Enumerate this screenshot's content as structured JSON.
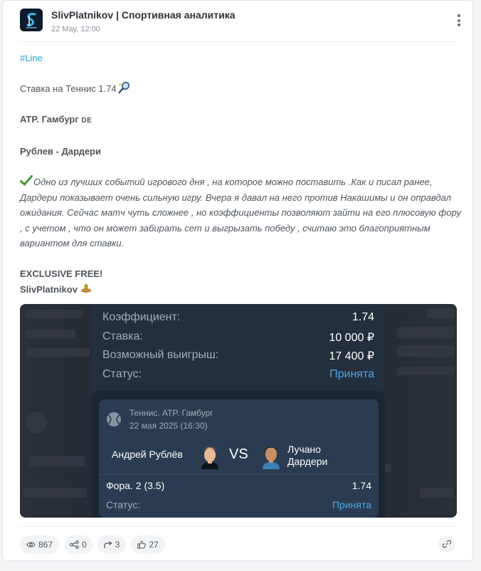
{
  "channel": {
    "name": "SlivPlatnikov | Спортивная аналитика",
    "date": "22 May, 12:00"
  },
  "post": {
    "hashtag": "#Line",
    "bet_line": "Ставка на Теннис 1.74",
    "tournament": "ATP. Гамбург",
    "flag": "DE",
    "match": "Рублев - Дардери",
    "analysis": "Одно из лучших событий игрового дня , на которое можно поставить .Как и писал ранее, Дардери показывает очень сильную игру. Вчера я давал на него против Накашимы и он оправдал ожидания. Сейчас матч чуть сложнее , но коэффициенты позволяют зайти на его плюсовую фору , с учетом , что он может забирать сет и выгрызать победу , считаю это благоприятным вариантом для ставки.",
    "exclusive": "EXCLUSIVE FREE!",
    "signature": "SlivPlatnikov",
    "icons": [
      "tennis-racket-icon",
      "check-mark-icon",
      "fleur-de-lis-icon"
    ]
  },
  "screenshot": {
    "coef_label": "Коэффициент:",
    "coef_value": "1.74",
    "stake_label": "Ставка:",
    "stake_value": "10 000 ₽",
    "win_label": "Возможный выигрыш:",
    "win_value": "17 400 ₽",
    "status_label": "Статус:",
    "status_value": "Принята",
    "bet": {
      "tournament": "Теннис. ATP. Гамбург",
      "datetime": "22 мая 2025 (16:30)",
      "player1": "Андрей Рублёв",
      "vs": "VS",
      "player2_first": "Лучано",
      "player2_last": "Дардери",
      "market": "Фора. 2 (3.5)",
      "odds": "1.74",
      "status_label": "Статус:",
      "status_value": "Принята"
    }
  },
  "stats": {
    "views": "867",
    "shares": "0",
    "forwards": "3",
    "likes": "27"
  },
  "colors": {
    "hashtag": "#22a4cf",
    "accepted": "#4ea6e6",
    "panel": "#242f3e",
    "text": "#4e555c"
  }
}
